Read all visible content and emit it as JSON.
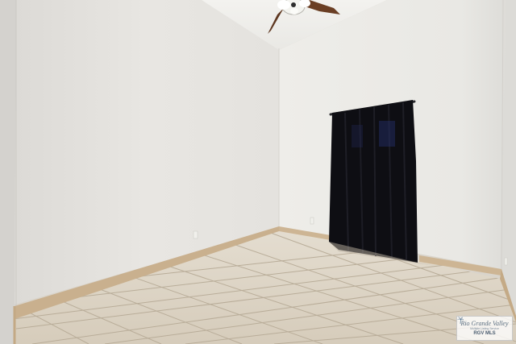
{
  "scene": {
    "description_colors": {
      "left_wall": "#e9e7e3",
      "right_wall": "#ecebe7",
      "ceiling": "#f0efec",
      "baseboard": "#c8ae8c",
      "floor_tile": "#ded6c8",
      "grout": "#b7ab98",
      "curtain": "#0d0d12",
      "fan_blade": "#6a3e24"
    }
  },
  "watermark": {
    "brand": "Rio Grande Valley",
    "subtitle": "Multiple Listing Service",
    "mls": "RGV MLS"
  }
}
